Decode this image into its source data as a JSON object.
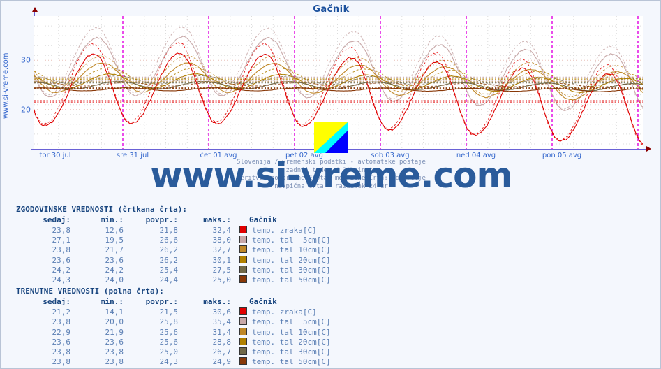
{
  "page": {
    "site_watermark": "www.si-vreme.com",
    "vertical_watermark": "www.si-vreme.com"
  },
  "chart_data": {
    "type": "line",
    "title": "Gačnik",
    "xlabel": "",
    "ylabel": "",
    "ylim": [
      12,
      39
    ],
    "yticks": [
      20,
      30
    ],
    "ytick_labels": [
      "20",
      "30"
    ],
    "grid": true,
    "legend_position": "below-table",
    "x_tick_labels": [
      "tor 30 jul",
      "sre 31 jul",
      "čet 01 avg",
      "pet 02 avg",
      "sob 03 avg",
      "ned 04 avg",
      "pon 05 avg"
    ],
    "day_divider_note": "navpična črta - razdelek 24 ur",
    "series": [
      {
        "name": "temp. zraka[C]",
        "color": "#e00000",
        "style": "solid",
        "values": [
          21.5,
          30.6,
          14.1,
          21.2
        ]
      },
      {
        "name": "temp. tal  5cm[C]",
        "color": "#c8a8a8",
        "style": "solid",
        "values": [
          25.8,
          35.4,
          20.0,
          23.8
        ]
      },
      {
        "name": "temp. tal 10cm[C]",
        "color": "#c08828",
        "style": "solid",
        "values": [
          25.6,
          31.4,
          21.9,
          22.9
        ]
      },
      {
        "name": "temp. tal 20cm[C]",
        "color": "#b08000",
        "style": "solid",
        "values": [
          25.6,
          28.8,
          23.6,
          23.6
        ]
      },
      {
        "name": "temp. tal 30cm[C]",
        "color": "#706848",
        "style": "solid",
        "values": [
          25.0,
          26.7,
          23.8,
          23.8
        ]
      },
      {
        "name": "temp. tal 50cm[C]",
        "color": "#883808",
        "style": "solid",
        "values": [
          24.3,
          24.9,
          23.8,
          23.8
        ]
      },
      {
        "name": "temp. zraka[C] (zgod.)",
        "color": "#e00000",
        "style": "dashed",
        "values": [
          21.8,
          32.4,
          12.6,
          23.8
        ]
      },
      {
        "name": "temp. tal  5cm[C] (zgod.)",
        "color": "#c8a8a8",
        "style": "dashed",
        "values": [
          26.6,
          38.0,
          19.5,
          27.1
        ]
      },
      {
        "name": "temp. tal 10cm[C] (zgod.)",
        "color": "#c08828",
        "style": "dashed",
        "values": [
          26.2,
          32.7,
          21.7,
          23.8
        ]
      },
      {
        "name": "temp. tal 20cm[C] (zgod.)",
        "color": "#b08000",
        "style": "dashed",
        "values": [
          26.2,
          30.1,
          23.6,
          23.6
        ]
      },
      {
        "name": "temp. tal 30cm[C] (zgod.)",
        "color": "#706848",
        "style": "dashed",
        "values": [
          25.4,
          27.5,
          24.2,
          24.2
        ]
      },
      {
        "name": "temp. tal 50cm[C] (zgod.)",
        "color": "#883808",
        "style": "dashed",
        "values": [
          24.4,
          25.0,
          24.0,
          24.3
        ]
      }
    ]
  },
  "footer": {
    "line1": "Slovenija / vremenski podatki - avtomatske postaje",
    "line2": "zadnji teden / 30 minut.",
    "line3": "Meritve: povprečne  Enota: metrične  Črta: povprečje",
    "line4": "navpična črta - razdelek 24 ur"
  },
  "tables": [
    {
      "id": "historic",
      "title": "ZGODOVINSKE VREDNOSTI (črtkana črta):",
      "headers": [
        "sedaj:",
        "min.:",
        "povpr.:",
        "maks.:",
        "Gačnik"
      ],
      "rows": [
        {
          "sedaj": "23,8",
          "min": "12,6",
          "povpr": "21,8",
          "maks": "32,4",
          "series": "temp. zraka[C]",
          "color": "#e00000"
        },
        {
          "sedaj": "27,1",
          "min": "19,5",
          "povpr": "26,6",
          "maks": "38,0",
          "series": "temp. tal  5cm[C]",
          "color": "#c8a8a8"
        },
        {
          "sedaj": "23,8",
          "min": "21,7",
          "povpr": "26,2",
          "maks": "32,7",
          "series": "temp. tal 10cm[C]",
          "color": "#c08828"
        },
        {
          "sedaj": "23,6",
          "min": "23,6",
          "povpr": "26,2",
          "maks": "30,1",
          "series": "temp. tal 20cm[C]",
          "color": "#b08000"
        },
        {
          "sedaj": "24,2",
          "min": "24,2",
          "povpr": "25,4",
          "maks": "27,5",
          "series": "temp. tal 30cm[C]",
          "color": "#706848"
        },
        {
          "sedaj": "24,3",
          "min": "24,0",
          "povpr": "24,4",
          "maks": "25,0",
          "series": "temp. tal 50cm[C]",
          "color": "#883808"
        }
      ]
    },
    {
      "id": "current",
      "title": "TRENUTNE VREDNOSTI (polna črta):",
      "headers": [
        "sedaj:",
        "min.:",
        "povpr.:",
        "maks.:",
        "Gačnik"
      ],
      "rows": [
        {
          "sedaj": "21,2",
          "min": "14,1",
          "povpr": "21,5",
          "maks": "30,6",
          "series": "temp. zraka[C]",
          "color": "#e00000"
        },
        {
          "sedaj": "23,8",
          "min": "20,0",
          "povpr": "25,8",
          "maks": "35,4",
          "series": "temp. tal  5cm[C]",
          "color": "#c8a8a8"
        },
        {
          "sedaj": "22,9",
          "min": "21,9",
          "povpr": "25,6",
          "maks": "31,4",
          "series": "temp. tal 10cm[C]",
          "color": "#c08828"
        },
        {
          "sedaj": "23,6",
          "min": "23,6",
          "povpr": "25,6",
          "maks": "28,8",
          "series": "temp. tal 20cm[C]",
          "color": "#b08000"
        },
        {
          "sedaj": "23,8",
          "min": "23,8",
          "povpr": "25,0",
          "maks": "26,7",
          "series": "temp. tal 30cm[C]",
          "color": "#706848"
        },
        {
          "sedaj": "23,8",
          "min": "23,8",
          "povpr": "24,3",
          "maks": "24,9",
          "series": "temp. tal 50cm[C]",
          "color": "#883808"
        }
      ]
    }
  ],
  "colors": {
    "title": "#1a4f9c",
    "axis": "#6a62d6",
    "day_divider": "#e000e0",
    "grid": "#d8d8d8",
    "watermark": "#2a5b9b",
    "table_header": "#17447e",
    "table_value": "#5b7fb4"
  }
}
